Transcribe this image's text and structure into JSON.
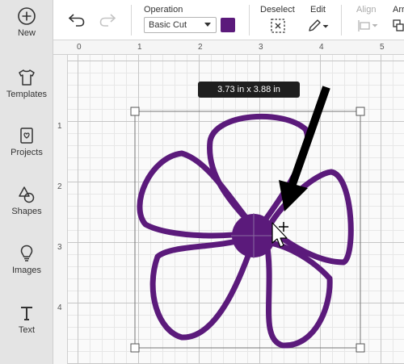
{
  "sidebar": {
    "items": [
      {
        "label": "New",
        "icon": "plus-circle-icon"
      },
      {
        "label": "Templates",
        "icon": "tshirt-icon"
      },
      {
        "label": "Projects",
        "icon": "heart-card-icon"
      },
      {
        "label": "Shapes",
        "icon": "shapes-icon"
      },
      {
        "label": "Images",
        "icon": "lightbulb-icon"
      },
      {
        "label": "Text",
        "icon": "text-t-icon"
      }
    ]
  },
  "toolbar": {
    "undo_icon": "undo-icon",
    "redo_icon": "redo-icon",
    "operation_label": "Operation",
    "operation_value": "Basic Cut",
    "operation_color": "#5b1a7b",
    "deselect_label": "Deselect",
    "edit_label": "Edit",
    "align_label": "Align",
    "arrange_label": "Arr"
  },
  "ruler": {
    "top": [
      "0",
      "1",
      "2",
      "3",
      "4",
      "5"
    ],
    "left": [
      "1",
      "2",
      "3",
      "4"
    ]
  },
  "canvas": {
    "dimension_tooltip": "3.73  in x 3.88  in",
    "shape_color": "#5b1a7b"
  }
}
